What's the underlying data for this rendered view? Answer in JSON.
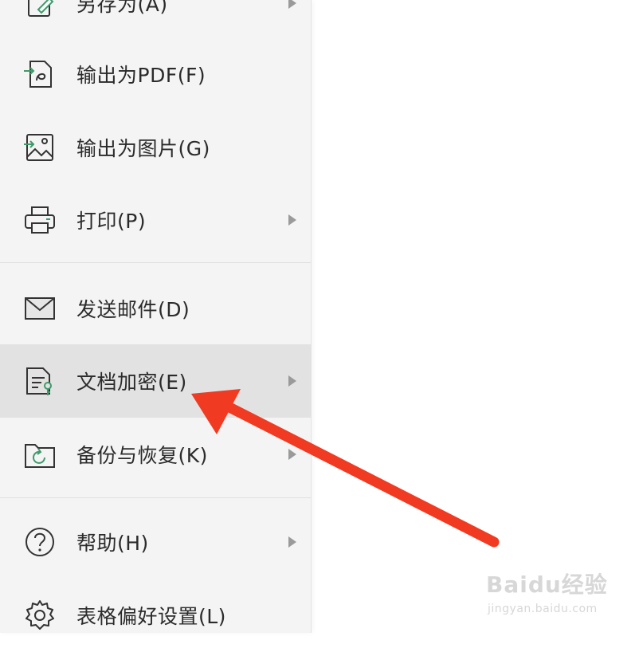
{
  "menu": {
    "items": [
      {
        "label": "另存为(A)",
        "icon": "save-as-icon",
        "has_submenu": true
      },
      {
        "label": "输出为PDF(F)",
        "icon": "export-pdf-icon",
        "has_submenu": false
      },
      {
        "label": "输出为图片(G)",
        "icon": "export-image-icon",
        "has_submenu": false
      },
      {
        "label": "打印(P)",
        "icon": "printer-icon",
        "has_submenu": true
      },
      {
        "label": "发送邮件(D)",
        "icon": "mail-icon",
        "has_submenu": false
      },
      {
        "label": "文档加密(E)",
        "icon": "document-encrypt-icon",
        "has_submenu": true,
        "highlighted": true
      },
      {
        "label": "备份与恢复(K)",
        "icon": "backup-restore-icon",
        "has_submenu": true
      },
      {
        "label": "帮助(H)",
        "icon": "help-icon",
        "has_submenu": true
      },
      {
        "label": "表格偏好设置(L)",
        "icon": "settings-gear-icon",
        "has_submenu": false
      }
    ]
  },
  "annotation": {
    "color": "#f03a22",
    "points_to": "文档加密(E)"
  },
  "watermark": {
    "logo": "Baidu经验",
    "url": "jingyan.baidu.com"
  },
  "colors": {
    "menu_bg": "#f4f4f4",
    "highlight_bg": "#e2e2e2",
    "icon_accent": "#3f9a6a",
    "text": "#2b2b2b"
  }
}
